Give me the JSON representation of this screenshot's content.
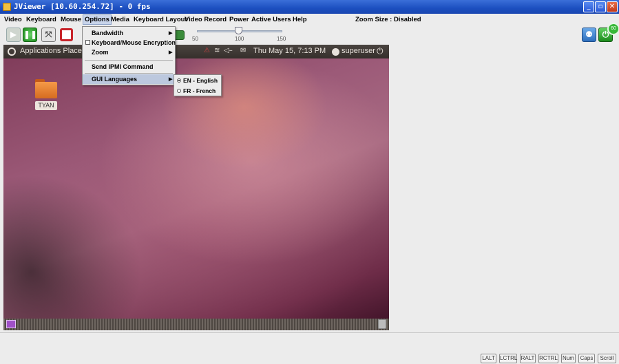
{
  "window": {
    "title": "JViewer [10.60.254.72] - 0 fps",
    "controls": {
      "minimize": "_",
      "maximize": "▫",
      "close": "✕"
    }
  },
  "menubar": {
    "items": [
      "Video",
      "Keyboard",
      "Mouse",
      "Options",
      "Media",
      "Keyboard Layout",
      "Video Record",
      "Power",
      "Active Users",
      "Help"
    ],
    "active_item": "Options",
    "zoom_status": "Zoom Size : Disabled"
  },
  "toolbar": {
    "slider": {
      "min_label": "50",
      "mid_label": "100",
      "max_label": "150",
      "value_percent": 100
    },
    "badge_text": "60"
  },
  "options_menu": {
    "items": [
      {
        "label": "Bandwidth",
        "has_submenu": true
      },
      {
        "label": "Keyboard/Mouse Encryption",
        "checkbox": true,
        "checked": false
      },
      {
        "label": "Zoom",
        "has_submenu": true
      },
      {
        "label": "Send IPMI Command",
        "has_submenu": false
      },
      {
        "label": "GUI Languages",
        "has_submenu": true,
        "highlighted": true
      }
    ]
  },
  "languages_submenu": {
    "items": [
      {
        "label": "EN - English",
        "selected": true
      },
      {
        "label": "FR - French",
        "selected": false
      }
    ]
  },
  "remote_desktop": {
    "panel": {
      "applications": "Applications",
      "places": "Places",
      "clock": "Thu May 15,  7:13 PM",
      "user": "superuser"
    },
    "desktop_icon_label": "TYAN"
  },
  "status_keys": [
    "LALT",
    "LCTRL",
    "RALT",
    "RCTRL",
    "Num",
    "Caps",
    "Scroll"
  ],
  "colors": {
    "titlebar": "#1c4fc0",
    "menu_highlight": "#bcc8de",
    "wallpaper_base": "#9c5a78"
  }
}
